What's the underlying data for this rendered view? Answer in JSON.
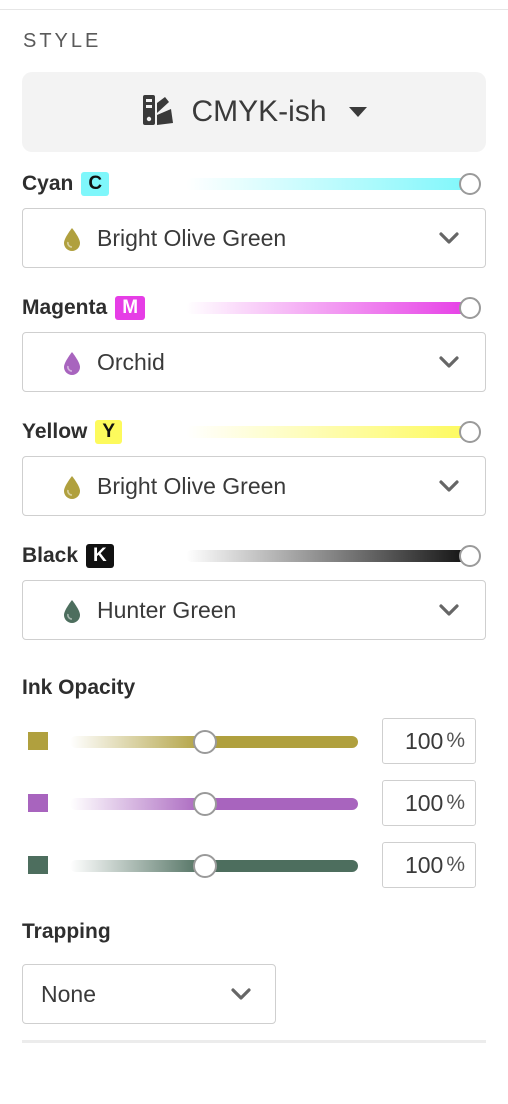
{
  "section_title": "STYLE",
  "style_select": {
    "label": "CMYK-ish",
    "icon": "swatchbook-icon"
  },
  "channels": [
    {
      "name": "Cyan",
      "badge": "C",
      "badge_bg": "#7ff7fb",
      "badge_fg": "#111111",
      "color": "#7ff7fb",
      "ink": "Bright Olive Green",
      "ink_color": "#b0a03e",
      "value": 1.0
    },
    {
      "name": "Magenta",
      "badge": "M",
      "badge_bg": "#e63de6",
      "badge_fg": "#ffffff",
      "color": "#e63de6",
      "ink": "Orchid",
      "ink_color": "#a864be",
      "value": 1.0
    },
    {
      "name": "Yellow",
      "badge": "Y",
      "badge_bg": "#fdfa5c",
      "badge_fg": "#111111",
      "color": "#fdfa5c",
      "ink": "Bright Olive Green",
      "ink_color": "#b0a03e",
      "value": 1.0
    },
    {
      "name": "Black",
      "badge": "K",
      "badge_bg": "#111111",
      "badge_fg": "#ffffff",
      "color": "#111111",
      "ink": "Hunter Green",
      "ink_color": "#4d6e5e",
      "value": 1.0
    }
  ],
  "ink_opacity": {
    "title": "Ink Opacity",
    "rows": [
      {
        "color": "#b0a03e",
        "value": "100",
        "unit": "%",
        "slider_level": 0.47
      },
      {
        "color": "#a864be",
        "value": "100",
        "unit": "%",
        "slider_level": 0.47
      },
      {
        "color": "#4d6e5e",
        "value": "100",
        "unit": "%",
        "slider_level": 0.47
      }
    ]
  },
  "trapping": {
    "title": "Trapping",
    "value": "None"
  }
}
